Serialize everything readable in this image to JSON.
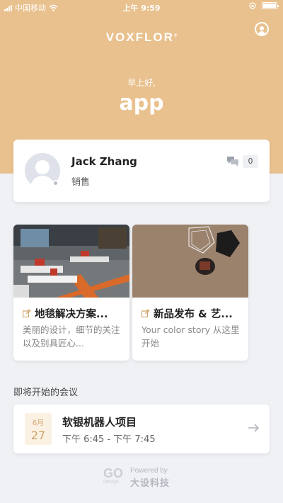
{
  "status_bar": {
    "carrier": "中国移动",
    "time": "上午 9:59",
    "battery_percent": 100
  },
  "header": {
    "logo_text": "VOXFLOR",
    "logo_mark": "®",
    "greeting": "早上好,",
    "app_name": "app",
    "profile_icon": "user-circle-icon"
  },
  "user": {
    "name": "Jack Zhang",
    "role": "销售",
    "message_count": "0",
    "message_icon": "chat-bubbles-icon"
  },
  "news": [
    {
      "title": "地毯解决方案...",
      "description": "美丽的设计，细节的关注以及别具匠心...",
      "icon": "external-link-icon"
    },
    {
      "title": "新品发布 & 艺...",
      "description": "Your color story 从这里开始",
      "icon": "external-link-icon"
    }
  ],
  "meetings": {
    "section_title": "即将开始的会议",
    "items": [
      {
        "month": "6月",
        "day": "27",
        "title": "软银机器人项目",
        "time": "下午 6:45 - 下午 7:45",
        "action_icon": "arrow-right-icon"
      }
    ]
  },
  "footer": {
    "go_mark": "GO",
    "go_sub": "Design",
    "powered_by": "Powered by",
    "brand": "大设科技"
  },
  "colors": {
    "hero": "#e9c18e",
    "accent": "#d1a36a",
    "background": "#eff1f5"
  }
}
